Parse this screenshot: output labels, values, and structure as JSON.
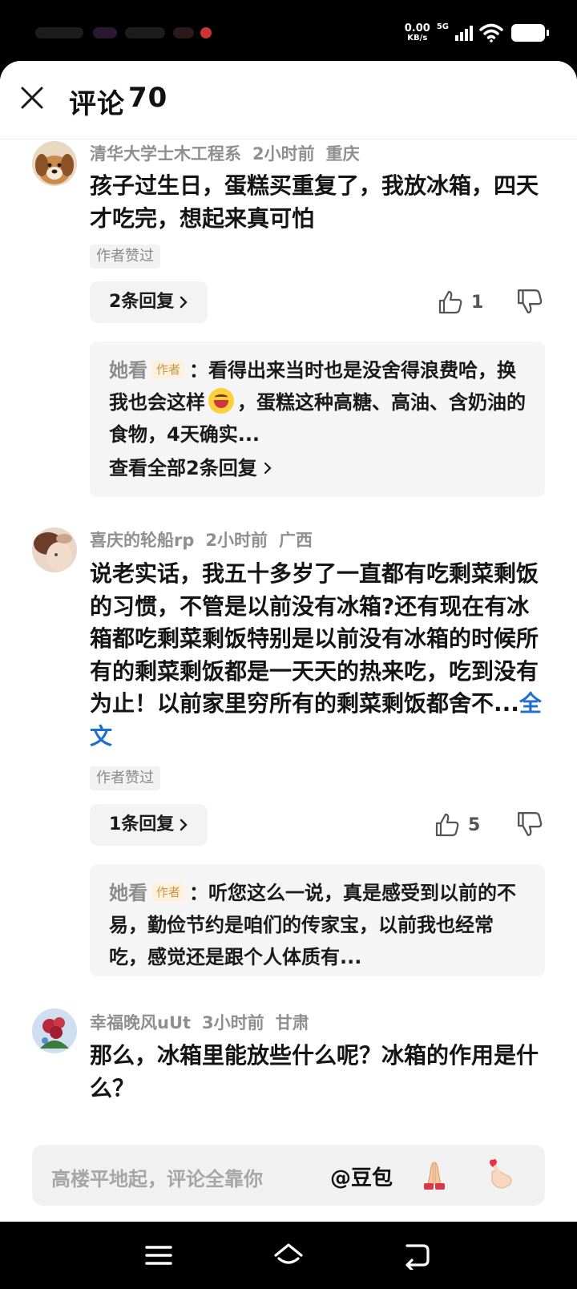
{
  "status_bar": {
    "speed_value": "0.00",
    "speed_unit": "KB/s",
    "network": "5G"
  },
  "sheet": {
    "title": "评论",
    "count": "70"
  },
  "comments": [
    {
      "author": "清华大学士木工程系",
      "time": "2小时前",
      "location": "重庆",
      "text": "孩子过生日，蛋糕买重复了，我放冰箱，四天才吃完，想起来真可怕",
      "author_liked": "作者赞过",
      "replies_label": "2条回复",
      "likes": "1",
      "reply_preview": {
        "author": "她看",
        "tag": "作者",
        "text_before_emoji": "：看得出来当时也是没舍得浪费哈，换我也会这样",
        "text_after_emoji": "，蛋糕这种高糖、高油、含奶油的食物，4天确实...",
        "view_all": "查看全部2条回复"
      }
    },
    {
      "author": "喜庆的轮船rp",
      "time": "2小时前",
      "location": "广西",
      "text": "说老实话，我五十多岁了一直都有吃剩菜剩饭的习惯，不管是以前没有冰箱?还有现在有冰箱都吃剩菜剩饭特别是以前没有冰箱的时候所有的剩菜剩饭都是一天天的热来吃，吃到没有为止！以前家里穷所有的剩菜剩饭都舍不...",
      "more_label": "全文",
      "author_liked": "作者赞过",
      "replies_label": "1条回复",
      "likes": "5",
      "reply_preview": {
        "author": "她看",
        "tag": "作者",
        "text": "：听您这么一说，真是感受到以前的不易，勤俭节约是咱们的传家宝，以前我也经常吃，感觉还是跟个人体质有..."
      }
    },
    {
      "author": "幸福晚风uUt",
      "time": "3小时前",
      "location": "甘肃",
      "text": "那么，冰箱里能放些什么呢？冰箱的作用是什么？"
    }
  ],
  "input_bar": {
    "placeholder": "高楼平地起，评论全靠你",
    "mention": "@豆包"
  },
  "icons": {
    "close": "close-icon",
    "like": "thumb-up-icon",
    "dislike": "thumb-down-icon",
    "emoji_grin": "grinning-face-emoji",
    "pray": "folded-hands-emoji",
    "finger_heart": "finger-heart-emoji",
    "nav_menu": "menu-icon",
    "nav_home": "home-icon",
    "nav_back": "back-icon"
  },
  "colors": {
    "link": "#1c6fd1",
    "author_tag_bg": "#fdf1dc",
    "author_tag_text": "#c9974b"
  }
}
